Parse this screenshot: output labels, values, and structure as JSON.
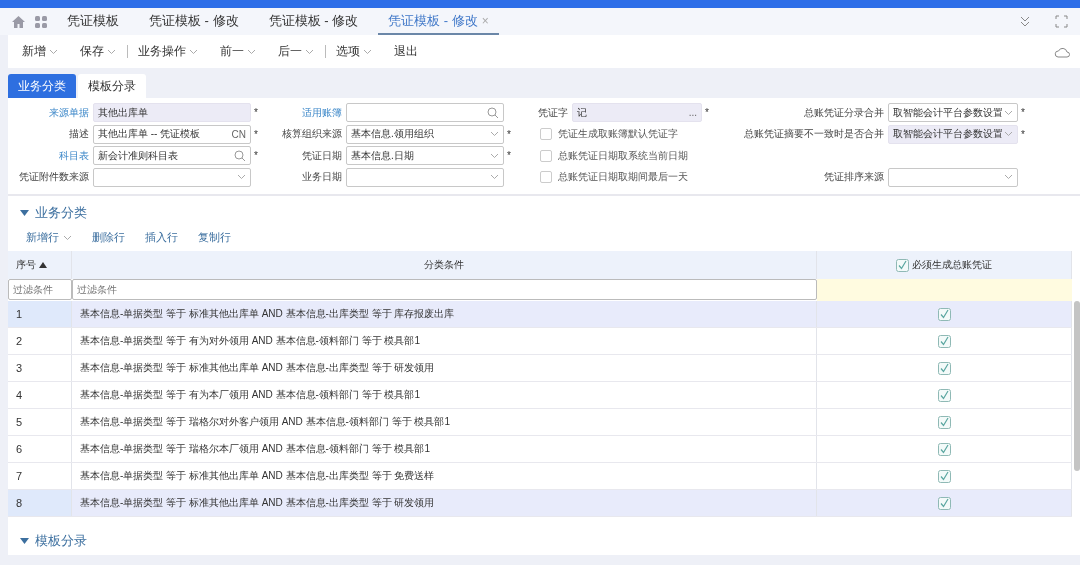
{
  "page_tabs": [
    {
      "label": "凭证模板",
      "selected": false,
      "closable": false
    },
    {
      "label": "凭证模板 - 修改",
      "selected": false,
      "closable": false
    },
    {
      "label": "凭证模板 - 修改",
      "selected": false,
      "closable": false
    },
    {
      "label": "凭证模板 - 修改",
      "selected": true,
      "closable": true
    }
  ],
  "close_glyph": "×",
  "toolbar": [
    {
      "label": "新增",
      "dropdown": true,
      "divider_after": false
    },
    {
      "label": "保存",
      "dropdown": true,
      "divider_after": true
    },
    {
      "label": "业务操作",
      "dropdown": true,
      "divider_after": false
    },
    {
      "label": "前一",
      "dropdown": true,
      "divider_after": false
    },
    {
      "label": "后一",
      "dropdown": true,
      "divider_after": true
    },
    {
      "label": "选项",
      "dropdown": true,
      "divider_after": false
    },
    {
      "label": "退出",
      "dropdown": false,
      "divider_after": false
    }
  ],
  "view_tabs": [
    {
      "label": "业务分类",
      "selected": true
    },
    {
      "label": "模板分录",
      "selected": false
    }
  ],
  "form": {
    "columns": [
      [
        {
          "kind": "text",
          "label": "来源单据",
          "value": "其他出库单",
          "link": true,
          "required": true,
          "disabled": true
        },
        {
          "kind": "lang",
          "label": "描述",
          "value": "其他出库单 -- 凭证模板",
          "link": false,
          "required": true,
          "disabled": false,
          "suffix": "CN"
        },
        {
          "kind": "search",
          "label": "科目表",
          "value": "新会计准则科目表",
          "link": true,
          "required": true,
          "disabled": false
        },
        {
          "kind": "select",
          "label": "凭证附件数来源",
          "link": false,
          "required": false,
          "disabled": false
        }
      ],
      [
        {
          "kind": "search",
          "label": "适用账簿",
          "link": true,
          "required": false,
          "disabled": false
        },
        {
          "kind": "select",
          "label": "核算组织来源",
          "value": "基本信息.领用组织",
          "link": false,
          "required": true,
          "disabled": false
        },
        {
          "kind": "select",
          "label": "凭证日期",
          "value": "基本信息.日期",
          "link": false,
          "required": true,
          "disabled": false
        },
        {
          "kind": "select",
          "label": "业务日期",
          "link": false,
          "required": false,
          "disabled": false
        }
      ],
      [
        {
          "kind": "lookup",
          "label": "凭证字",
          "value": "记",
          "link": false,
          "required": true,
          "disabled": true,
          "suffix": "..."
        },
        {
          "kind": "checkbox",
          "label": "凭证生成取账簿默认凭证字",
          "checked": false
        },
        {
          "kind": "checkbox",
          "label": "总账凭证日期取系统当前日期",
          "checked": false
        },
        {
          "kind": "checkbox",
          "label": "总账凭证日期取期间最后一天",
          "checked": false
        }
      ],
      [
        {
          "kind": "select",
          "label": "总账凭证分录合并",
          "value": "取智能会计平台参数设置",
          "link": false,
          "required": true,
          "disabled": false
        },
        {
          "kind": "select",
          "label": "总账凭证摘要不一致时是否合并",
          "value": "取智能会计平台参数设置",
          "link": false,
          "required": true,
          "disabled": true
        },
        {
          "kind": "blank"
        },
        {
          "kind": "select",
          "label": "凭证排序来源",
          "link": false,
          "required": false,
          "disabled": false
        }
      ]
    ],
    "required_mark": "*"
  },
  "section_1": {
    "title": "业务分类",
    "expanded": true,
    "actions": [
      {
        "label": "新增行",
        "dropdown": true
      },
      {
        "label": "删除行",
        "dropdown": false
      },
      {
        "label": "插入行",
        "dropdown": false
      },
      {
        "label": "复制行",
        "dropdown": false
      }
    ]
  },
  "table": {
    "columns": [
      {
        "label": "序号",
        "sorted": true,
        "kind": "text"
      },
      {
        "label": "分类条件",
        "sorted": false,
        "kind": "text"
      },
      {
        "label": "必须生成总账凭证",
        "sorted": false,
        "checked": true,
        "kind": "check"
      }
    ],
    "filter_placeholders": [
      "过滤条件",
      "过滤条件"
    ],
    "rows": [
      {
        "no": "1",
        "condition": "基本信息-单据类型 等于 标准其他出库单 AND 基本信息-出库类型 等于 库存报废出库",
        "checked": true,
        "selected": true
      },
      {
        "no": "2",
        "condition": "基本信息-单据类型 等于 有为对外领用 AND 基本信息-领料部门 等于 模具部1",
        "checked": true,
        "selected": false
      },
      {
        "no": "3",
        "condition": "基本信息-单据类型 等于 标准其他出库单 AND 基本信息-出库类型 等于 研发领用",
        "checked": true,
        "selected": false
      },
      {
        "no": "4",
        "condition": "基本信息-单据类型 等于 有为本厂领用 AND 基本信息-领料部门 等于 模具部1",
        "checked": true,
        "selected": false
      },
      {
        "no": "5",
        "condition": "基本信息-单据类型 等于 瑞格尔对外客户领用 AND 基本信息-领料部门 等于 模具部1",
        "checked": true,
        "selected": false
      },
      {
        "no": "6",
        "condition": "基本信息-单据类型 等于 瑞格尔本厂领用 AND 基本信息-领料部门 等于 模具部1",
        "checked": true,
        "selected": false
      },
      {
        "no": "7",
        "condition": "基本信息-单据类型 等于 标准其他出库单 AND 基本信息-出库类型 等于 免费送样",
        "checked": true,
        "selected": false
      },
      {
        "no": "8",
        "condition": "基本信息-单据类型 等于 标准其他出库单 AND 基本信息-出库类型 等于 研发领用",
        "checked": true,
        "selected": true
      }
    ]
  },
  "section_2": {
    "title": "模板分录",
    "expanded": true
  }
}
